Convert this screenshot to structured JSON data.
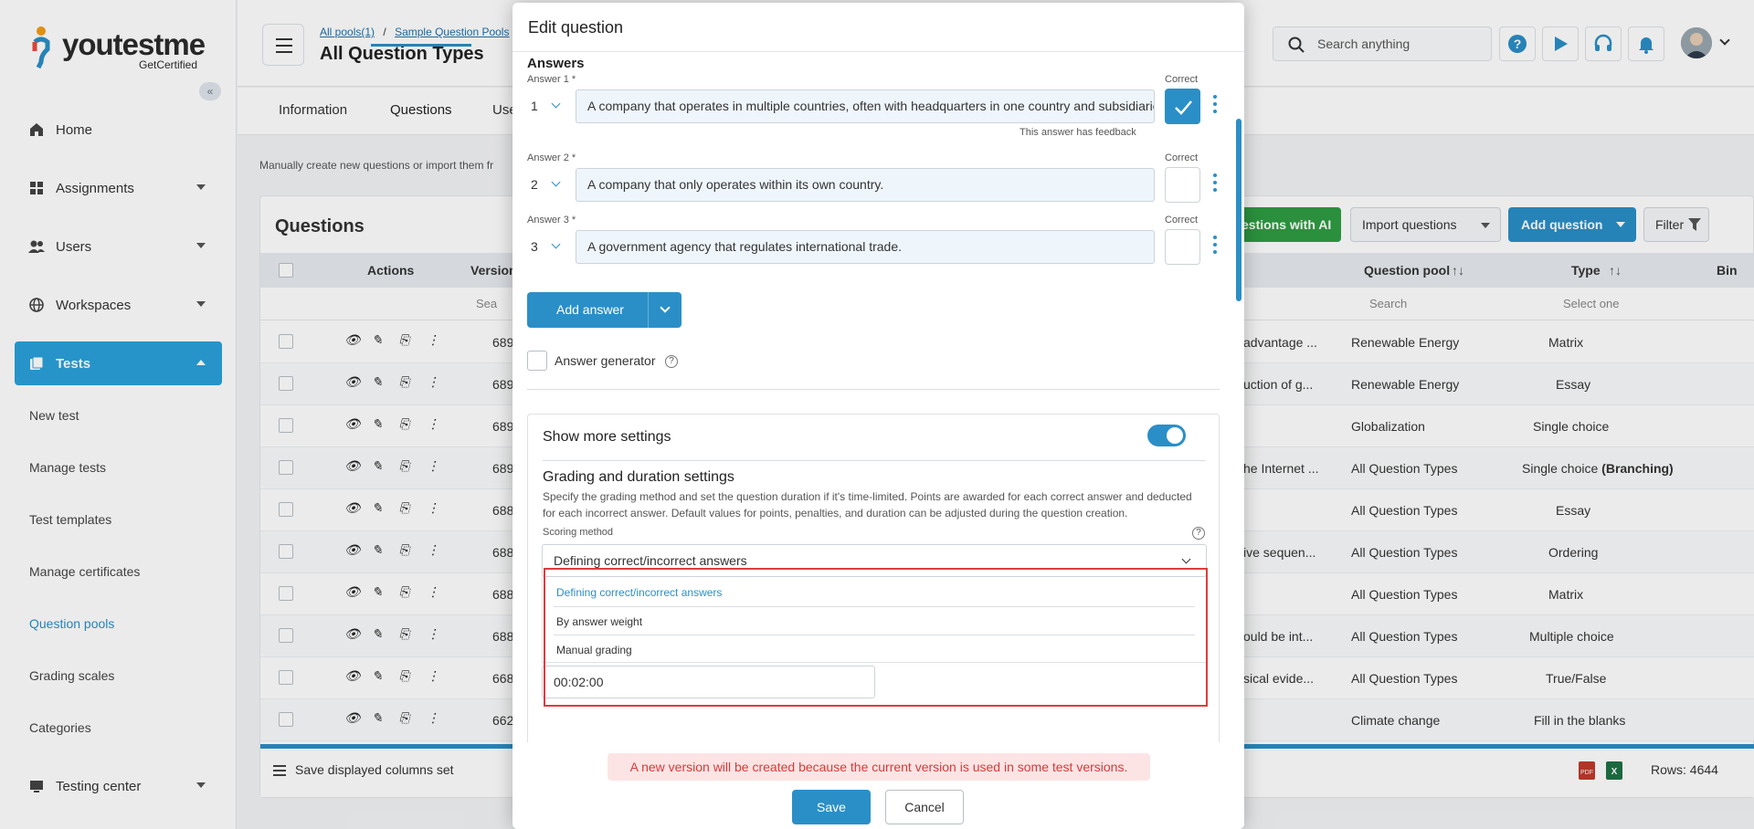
{
  "brand": {
    "name": "youtestme",
    "sub": "GetCertified"
  },
  "sidebar": {
    "items": [
      {
        "label": "Home"
      },
      {
        "label": "Assignments"
      },
      {
        "label": "Users"
      },
      {
        "label": "Workspaces"
      },
      {
        "label": "Tests"
      }
    ],
    "sub_items": [
      {
        "label": "New test"
      },
      {
        "label": "Manage tests"
      },
      {
        "label": "Test templates"
      },
      {
        "label": "Manage certificates"
      },
      {
        "label": "Question pools"
      },
      {
        "label": "Grading scales"
      },
      {
        "label": "Categories"
      }
    ],
    "testing_center": "Testing center"
  },
  "header": {
    "breadcrumb": [
      "All pools(1)",
      "/",
      "Sample Question Pools"
    ],
    "title": "All Question Types",
    "search_placeholder": "Search anything"
  },
  "tabs": [
    "Information",
    "Questions",
    "Use"
  ],
  "description": "Manually create new questions or import them fr",
  "questions": {
    "title": "Questions",
    "ai_button": "estions with AI",
    "import_button": "Import questions",
    "add_button": "Add question",
    "filter_button": "Filter",
    "columns": {
      "actions": "Actions",
      "version": "Version",
      "pool": "Question pool",
      "type": "Type",
      "bin": "Bin"
    },
    "filters": {
      "version": "Sea",
      "pool": "Search",
      "type": "Select one"
    },
    "rows": [
      {
        "id": "689",
        "text": "advantage ...",
        "pool": "Renewable Energy",
        "type": "Matrix"
      },
      {
        "id": "689",
        "text": "uction of g...",
        "pool": "Renewable Energy",
        "type": "Essay"
      },
      {
        "id": "689",
        "text": "",
        "pool": "Globalization",
        "type": "Single choice"
      },
      {
        "id": "689",
        "text": "he Internet ...",
        "pool": "All Question Types",
        "type": "Single choice",
        "type_bold": "(Branching)"
      },
      {
        "id": "688",
        "text": "",
        "pool": "All Question Types",
        "type": "Essay"
      },
      {
        "id": "688",
        "text": "ive sequen...",
        "pool": "All Question Types",
        "type": "Ordering"
      },
      {
        "id": "688",
        "text": "",
        "pool": "All Question Types",
        "type": "Matrix"
      },
      {
        "id": "688",
        "text": "ould be int...",
        "pool": "All Question Types",
        "type": "Multiple choice"
      },
      {
        "id": "668",
        "text": "sical evide...",
        "pool": "All Question Types",
        "type": "True/False"
      },
      {
        "id": "662",
        "text": "",
        "pool": "Climate change",
        "type": "Fill in the blanks"
      }
    ],
    "footer_label": "Save displayed columns set",
    "rows_count": "Rows: 4644"
  },
  "modal": {
    "title": "Edit question",
    "answers_heading": "Answers",
    "correct_label": "Correct",
    "answers": [
      {
        "label": "Answer 1 *",
        "num": "1",
        "text": "A company that operates in multiple countries, often with headquarters in one country and subsidiaries in others.",
        "correct": true,
        "note": "This answer has feedback"
      },
      {
        "label": "Answer 2 *",
        "num": "2",
        "text": "A company that only operates within its own country.",
        "correct": false
      },
      {
        "label": "Answer 3 *",
        "num": "3",
        "text": "A government agency that regulates international trade.",
        "correct": false
      }
    ],
    "add_answer": "Add answer",
    "answer_generator": "Answer generator",
    "show_more": "Show more settings",
    "grading_title": "Grading and duration settings",
    "grading_desc": "Specify the grading method and set the question duration if it's time-limited. Points are awarded for each correct answer and deducted for each incorrect answer. Default values for points, penalties, and duration can be adjusted during the question creation.",
    "scoring_label": "Scoring method",
    "scoring_value": "Defining correct/incorrect answers",
    "scoring_options": [
      "Defining correct/incorrect answers",
      "By answer weight",
      "Manual grading"
    ],
    "duration": "00:02:00",
    "warning": "A new version will be created because the current version is used in some test versions.",
    "save": "Save",
    "cancel": "Cancel"
  }
}
